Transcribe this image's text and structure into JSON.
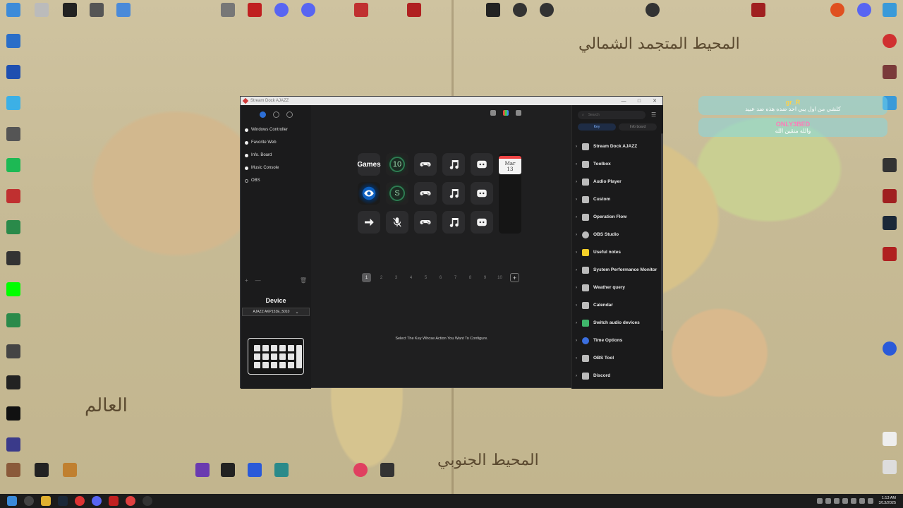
{
  "app": {
    "title": "Stream Dock AJAZZ",
    "window_controls": [
      "—",
      "□",
      "✕"
    ],
    "profiles": [
      {
        "label": "Windows Controller",
        "active": true
      },
      {
        "label": "Favorite Web",
        "active": true
      },
      {
        "label": "Info. Board",
        "active": true
      },
      {
        "label": "Music Console",
        "active": true
      },
      {
        "label": "OBS",
        "active": false
      }
    ],
    "left_ctrls": {
      "add": "+",
      "remove": "—",
      "trash": "🗑"
    },
    "device": {
      "title": "Device",
      "selected": "AJAZZ AKP153E_5010"
    },
    "keys": {
      "games_label": "Games",
      "ten_label": "10",
      "s_label": "S",
      "calendar_month": "Mar",
      "calendar_day": "13"
    },
    "pager": {
      "pages": [
        "1",
        "2",
        "3",
        "4",
        "5",
        "6",
        "7",
        "8",
        "9",
        "10"
      ],
      "current": "1",
      "add": "+"
    },
    "hint": "Select The Key Whose Action You Want To Configure.",
    "search": {
      "placeholder": "Search"
    },
    "tabs": [
      {
        "label": "Key",
        "active": true
      },
      {
        "label": "Info board",
        "active": false
      }
    ],
    "actions": [
      {
        "label": "Stream Dock AJAZZ",
        "icon": "stream-dock-icon",
        "color": "#bdbdbd"
      },
      {
        "label": "Toolbox",
        "icon": "toolbox-icon",
        "color": "#cfcfcf"
      },
      {
        "label": "Audio Player",
        "icon": "audio-player-icon",
        "color": "#cfcfcf"
      },
      {
        "label": "Custom",
        "icon": "custom-icon",
        "color": "#cfcfcf"
      },
      {
        "label": "Operation Flow",
        "icon": "operation-flow-icon",
        "color": "#cfcfcf"
      },
      {
        "label": "OBS Studio",
        "icon": "obs-icon",
        "color": "#cfcfcf"
      },
      {
        "label": "Useful notes",
        "icon": "notes-icon",
        "color": "#f5d028"
      },
      {
        "label": "System Performance Monitor",
        "icon": "monitor-icon",
        "color": "#cfcfcf"
      },
      {
        "label": "Weather query",
        "icon": "weather-icon",
        "color": "#cfcfcf"
      },
      {
        "label": "Calendar",
        "icon": "calendar-icon",
        "color": "#cfcfcf"
      },
      {
        "label": "Switch audio devices",
        "icon": "audio-switch-icon",
        "color": "#3fb66b"
      },
      {
        "label": "Time Options",
        "icon": "time-icon",
        "color": "#3b6fe0"
      },
      {
        "label": "OBS Tool",
        "icon": "obs-tool-icon",
        "color": "#cfcfcf"
      },
      {
        "label": "Discord",
        "icon": "discord-icon",
        "color": "#cfcfcf"
      }
    ]
  },
  "chat": [
    {
      "user": "gr_R",
      "text": "كلشي من اول يبي احد ضده هذه ضد عبيد"
    },
    {
      "user": "ONLY3BED",
      "text": "والله منقين الله"
    }
  ],
  "taskbar": {
    "time": "1:13 AM",
    "date": "3/13/2025"
  },
  "colors": {
    "accent": "#2d6fd6",
    "window_bg": "#1f1f20",
    "calendar_red": "#e44444"
  }
}
